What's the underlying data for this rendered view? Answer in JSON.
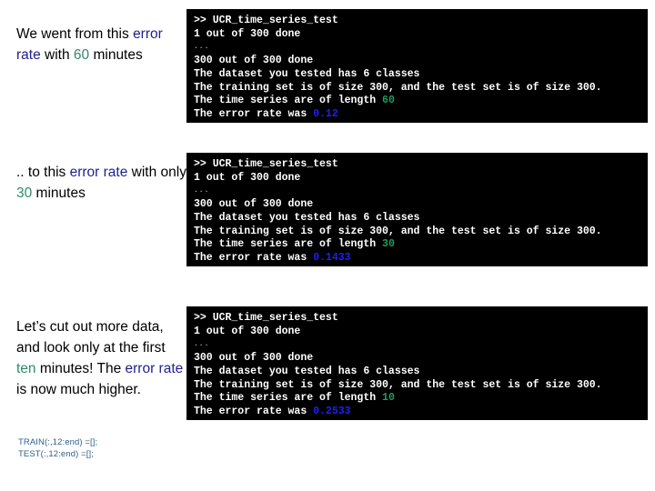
{
  "colors": {
    "console_bg": "#000000",
    "console_fg": "#ffffff",
    "highlight_blue": "#1f1f8f",
    "highlight_green": "#2e8b6b",
    "value_green": "#1f9d5c",
    "value_blue": "#2020ee",
    "code_note": "#2f5f8f"
  },
  "notes": [
    {
      "id": "note-60-minutes",
      "segments": [
        {
          "text": "We went from this ",
          "style": "plain"
        },
        {
          "text": "error rate",
          "style": "blue"
        },
        {
          "text": " with ",
          "style": "plain"
        },
        {
          "text": "60",
          "style": "green"
        },
        {
          "text": " minutes",
          "style": "plain"
        }
      ]
    },
    {
      "id": "note-30-minutes",
      "segments": [
        {
          "text": ".. to this ",
          "style": "plain"
        },
        {
          "text": "error rate",
          "style": "blue"
        },
        {
          "text": " with only ",
          "style": "plain"
        },
        {
          "text": "30",
          "style": "green"
        },
        {
          "text": " minutes",
          "style": "plain"
        }
      ]
    },
    {
      "id": "note-ten-minutes",
      "segments": [
        {
          "text": "Let’s cut out more data, and look only at the first ",
          "style": "plain"
        },
        {
          "text": "ten",
          "style": "green"
        },
        {
          "text": " minutes! The ",
          "style": "plain"
        },
        {
          "text": "error rate",
          "style": "blue"
        },
        {
          "text": " is now much higher.",
          "style": "plain"
        }
      ]
    }
  ],
  "code_note": {
    "line_1": "TRAIN(:,12:end) =[];",
    "line_2": "TEST(:,12:end) =[];"
  },
  "consoles": [
    {
      "id": "console-60",
      "lines": [
        {
          "type": "text",
          "text": ">> UCR_time_series_test"
        },
        {
          "type": "text",
          "text": "1 out of 300 done"
        },
        {
          "type": "ellipsis",
          "text": "..."
        },
        {
          "type": "text",
          "text": "300 out of 300 done"
        },
        {
          "type": "text",
          "text": "The dataset you tested has 6 classes"
        },
        {
          "type": "text",
          "text": "The training set is of size 300, and the test set is of size 300."
        },
        {
          "type": "value",
          "prefix": "The time series are of length ",
          "value": "60",
          "value_color": "green"
        },
        {
          "type": "value",
          "prefix": "The error rate was ",
          "value": "0.12",
          "value_color": "blue"
        }
      ]
    },
    {
      "id": "console-30",
      "lines": [
        {
          "type": "text",
          "text": ">> UCR_time_series_test"
        },
        {
          "type": "text",
          "text": "1 out of 300 done"
        },
        {
          "type": "ellipsis",
          "text": "..."
        },
        {
          "type": "text",
          "text": "300 out of 300 done"
        },
        {
          "type": "text",
          "text": "The dataset you tested has 6 classes"
        },
        {
          "type": "text",
          "text": "The training set is of size 300, and the test set is of size 300."
        },
        {
          "type": "value",
          "prefix": "The time series are of length ",
          "value": "30",
          "value_color": "green"
        },
        {
          "type": "value",
          "prefix": "The error rate was ",
          "value": "0.1433",
          "value_color": "blue"
        }
      ]
    },
    {
      "id": "console-10",
      "lines": [
        {
          "type": "text",
          "text": ">> UCR_time_series_test"
        },
        {
          "type": "text",
          "text": "1 out of 300 done"
        },
        {
          "type": "ellipsis",
          "text": "..."
        },
        {
          "type": "text",
          "text": "300 out of 300 done"
        },
        {
          "type": "text",
          "text": "The dataset you tested has 6 classes"
        },
        {
          "type": "text",
          "text": "The training set is of size 300, and the test set is of size 300."
        },
        {
          "type": "value",
          "prefix": "The time series are of length ",
          "value": "10",
          "value_color": "green"
        },
        {
          "type": "value",
          "prefix": "The error rate was ",
          "value": "0.2533",
          "value_color": "blue"
        }
      ]
    }
  ]
}
